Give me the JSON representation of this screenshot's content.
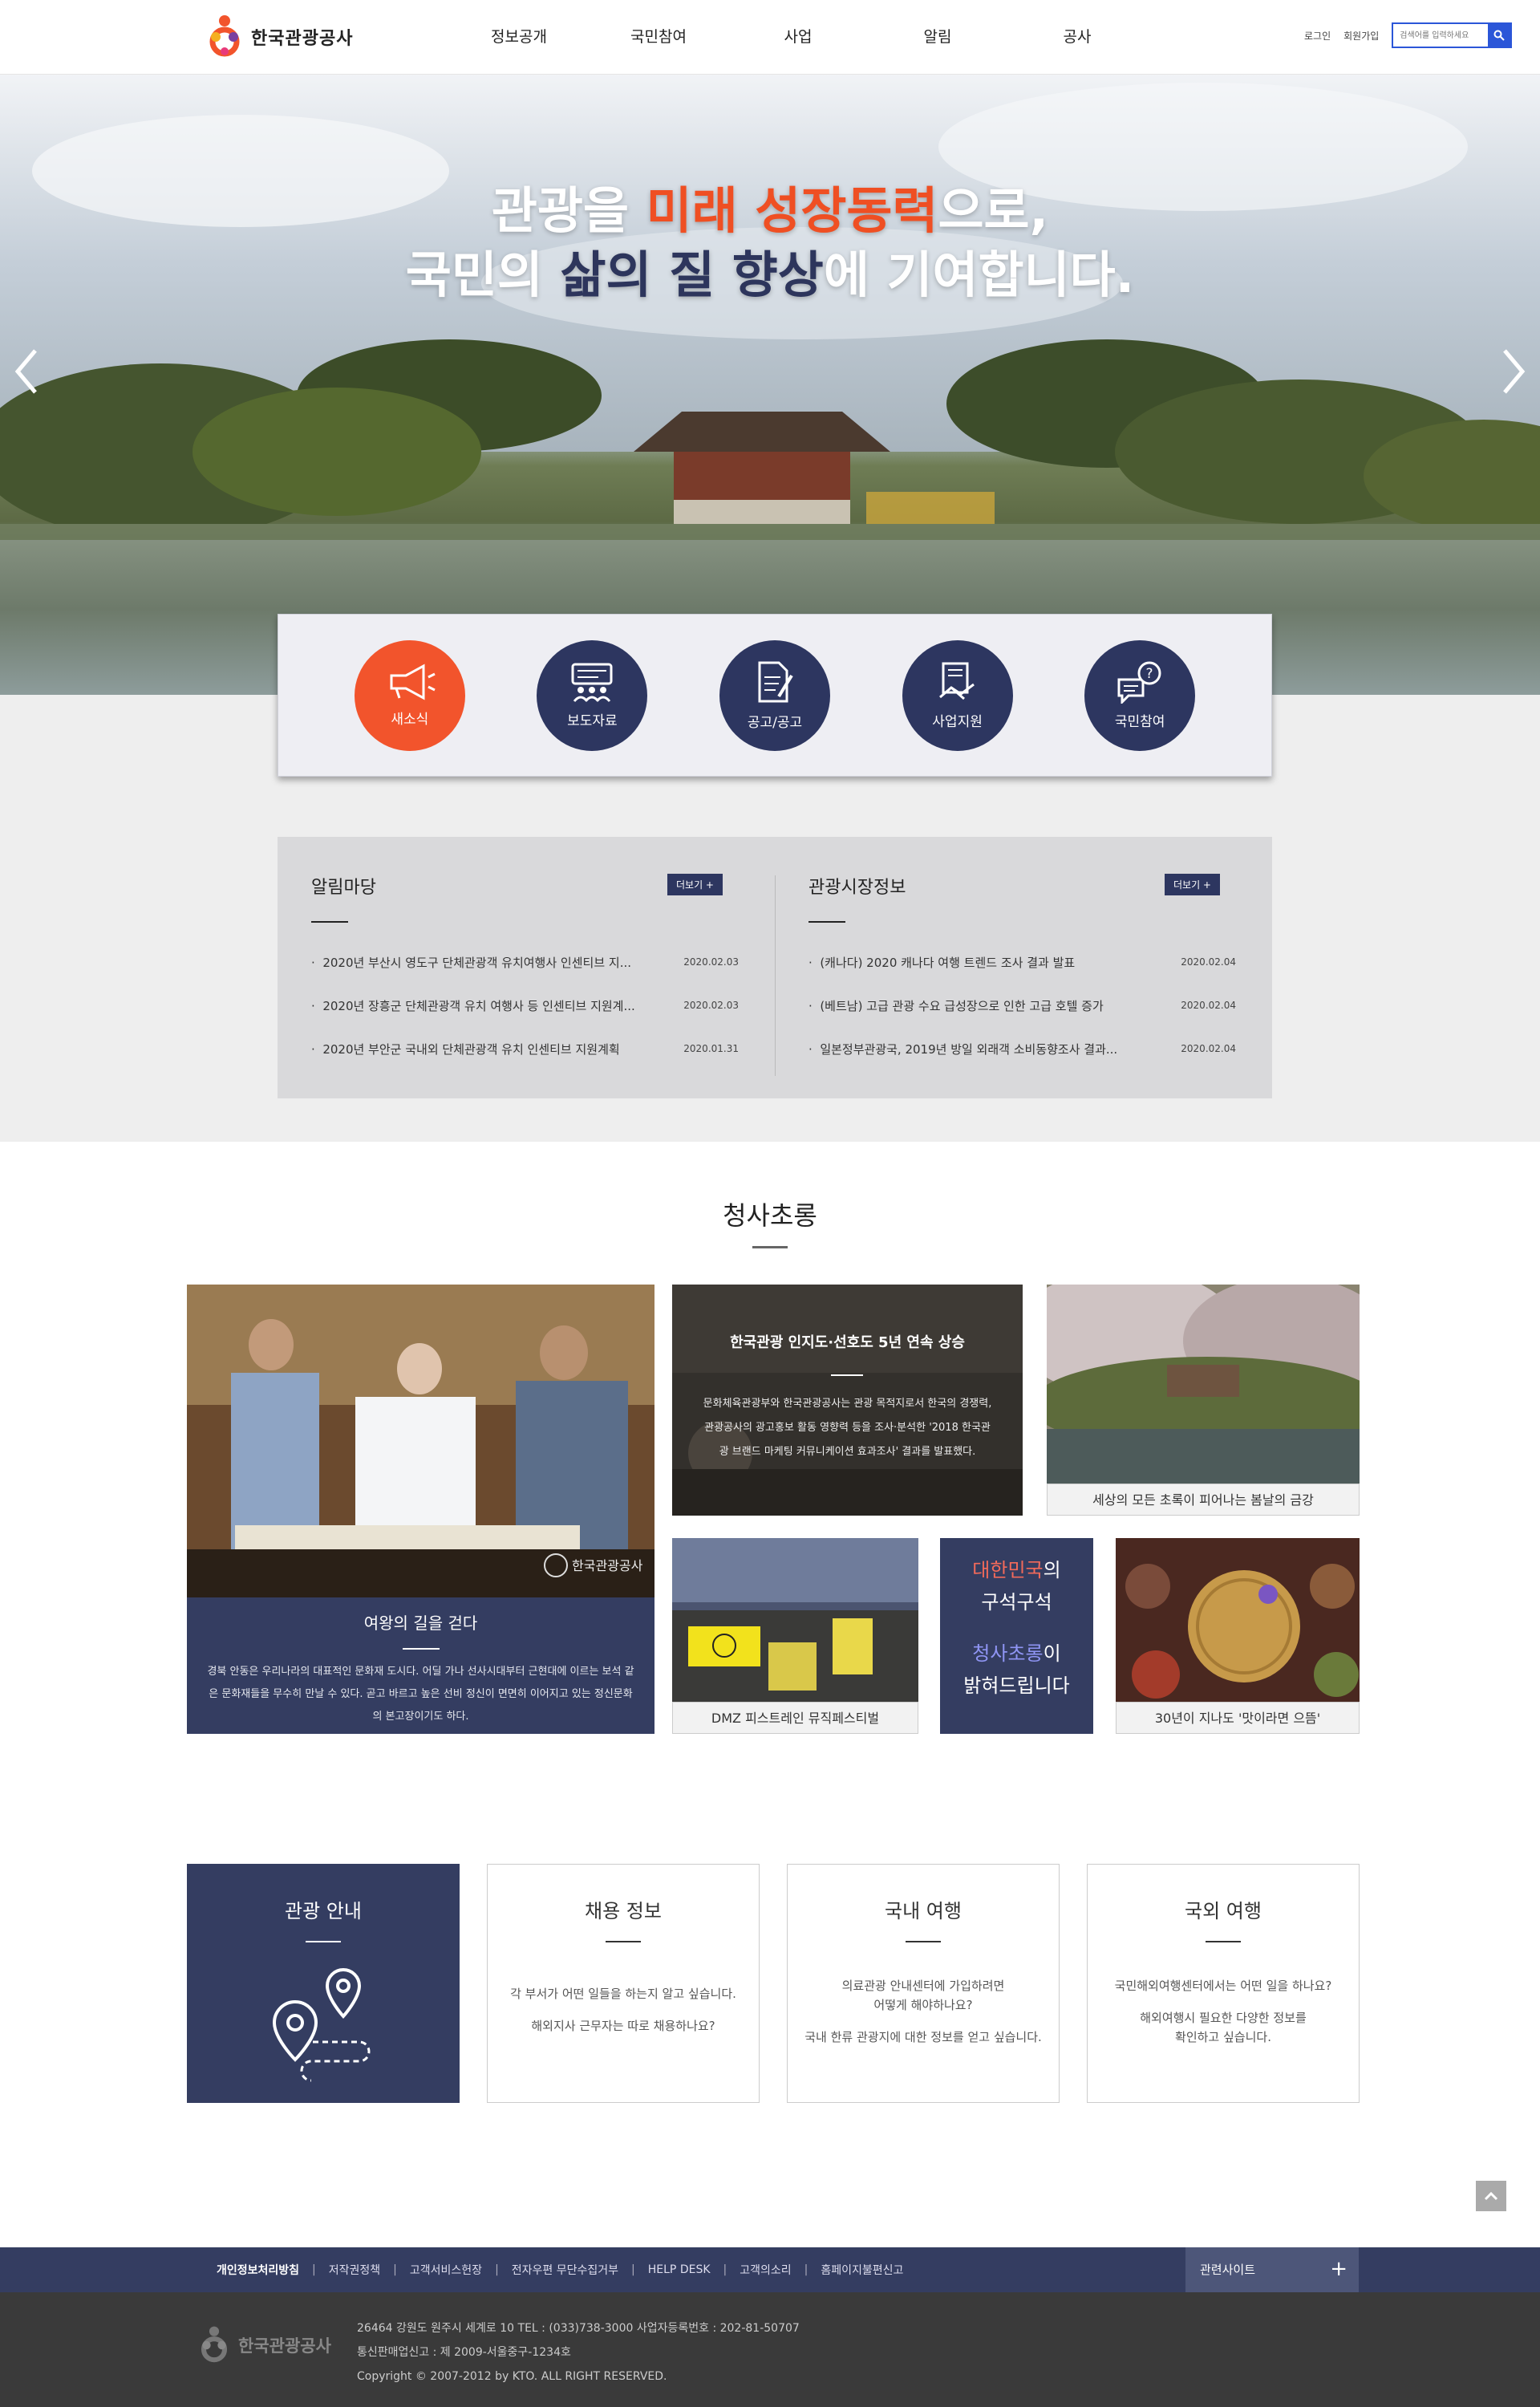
{
  "header": {
    "logo_text": "한국관광공사",
    "nav": [
      "정보공개",
      "국민참여",
      "사업",
      "알림",
      "공사"
    ],
    "login": "로그인",
    "signup": "회원가입",
    "search_placeholder": "검색어를 입력하세요"
  },
  "hero": {
    "line1_a": "관광을 ",
    "line1_b": "미래 성장동력",
    "line1_c": "으로,",
    "line2_a": "국민의 ",
    "line2_b": "삶의 질 향상",
    "line2_c": "에 기여합니다."
  },
  "quick_menu": [
    {
      "label": "새소식",
      "icon": "megaphone-icon"
    },
    {
      "label": "보도자료",
      "icon": "press-icon"
    },
    {
      "label": "공고/공고",
      "icon": "document-pen-icon"
    },
    {
      "label": "사업지원",
      "icon": "handshake-icon"
    },
    {
      "label": "국민참여",
      "icon": "question-bubble-icon"
    }
  ],
  "notice_board": {
    "title": "알림마당",
    "more": "더보기 +",
    "items": [
      {
        "title": "2020년 부산시 영도구 단체관광객 유치여행사 인센티브 지...",
        "date": "2020.02.03"
      },
      {
        "title": "2020년 장흥군 단체관광객 유치 여행사 등 인센티브 지원계...",
        "date": "2020.02.03"
      },
      {
        "title": "2020년 부안군 국내외 단체관광객 유치 인센티브 지원계획",
        "date": "2020.01.31"
      }
    ]
  },
  "market_board": {
    "title": "관광시장정보",
    "more": "더보기 +",
    "items": [
      {
        "title": "(캐나다) 2020 캐나다 여행 트렌드 조사 결과 발표",
        "date": "2020.02.04"
      },
      {
        "title": "(베트남) 고급 관광 수요 급성장으로 인한 고급 호텔 증가",
        "date": "2020.02.04"
      },
      {
        "title": "일본정부관광국, 2019년 방일 외래객 소비동향조사 결과...",
        "date": "2020.02.04"
      }
    ]
  },
  "blue_clear": {
    "title": "청사초롱",
    "queen": {
      "title": "여왕의 길을 걷다",
      "desc": "경북 안동은 우리나라의 대표적인 문화재 도시다. 어딜 가나 선사시대부터 근현대에 이르는 보석 같은 문화재들을 무수히 만날 수 있다. 곧고 바르고 높은 선비 정신이 면면히 이어지고 있는 정신문화의 본고장이기도 하다.",
      "watermark": "한국관광공사"
    },
    "brand": {
      "title": "한국관광 인지도·선호도 5년 연속 상승",
      "desc": "문화체육관광부와 한국관광공사는 관광 목적지로서 한국의 경쟁력, 관광공사의 광고홍보 활동 영향력 등을 조사·분석한 '2018 한국관광 브랜드 마케팅 커뮤니케이션 효과조사' 결과를 발표했다."
    },
    "spring": {
      "caption": "세상의 모든 초록이 피어나는 봄날의 금강"
    },
    "dmz": {
      "caption": "DMZ 피스트레인 뮤직페스티벌"
    },
    "slogan": {
      "a": "대한민국",
      "b": "의",
      "c": "구석구석",
      "d": "청사초롱",
      "e": "이",
      "f": "밝혀드립니다"
    },
    "food": {
      "caption": "30년이 지나도 '맛이라면 으뜸'"
    }
  },
  "info_boxes": [
    {
      "title": "관광 안내",
      "lines": []
    },
    {
      "title": "채용 정보",
      "lines": [
        "각 부서가 어떤 일들을 하는지 알고 싶습니다.",
        "",
        "해외지사 근무자는 따로 채용하나요?"
      ]
    },
    {
      "title": "국내 여행",
      "lines": [
        "의료관광 안내센터에 가입하려면",
        "어떻게 해야하나요?",
        "",
        "국내 한류 관광지에 대한 정보를 얻고 싶습니다."
      ]
    },
    {
      "title": "국외 여행",
      "lines": [
        "국민해외여행센터에서는 어떤 일을 하나요?",
        "",
        "해외여행시 필요한 다양한 정보를",
        "확인하고 싶습니다."
      ]
    }
  ],
  "footer": {
    "links": [
      "개인정보처리방침",
      "저작권정책",
      "고객서비스헌장",
      "전자우편 무단수집거부",
      "HELP DESK",
      "고객의소리",
      "홈페이지불편신고"
    ],
    "related": "관련사이트",
    "related_plus": "+",
    "logo_text": "한국관광공사",
    "address": "26464 강원도 원주시 세계로 10 TEL : (033)738-3000 사업자등록번호 : 202-81-50707",
    "report": "통신판매업신고 : 제 2009-서울중구-1234호",
    "copyright": "Copyright © 2007-2012 by KTO. ALL RIGHT RESERVED."
  },
  "colors": {
    "accent_red": "#ef4f23",
    "navy": "#2d3660",
    "search_blue": "#2b56d8"
  }
}
